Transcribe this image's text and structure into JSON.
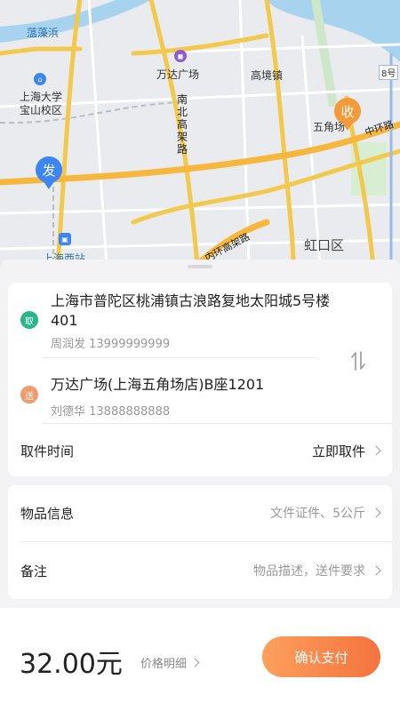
{
  "map": {
    "places": {
      "zaobang": "蕰藻浜",
      "wanda": "万达广场",
      "gaojing": "高境镇",
      "shu_univ": "上海大学",
      "shu_campus": "宝山校区",
      "wujiaochang": "五角场",
      "zhonghuan": "中环路",
      "hongkou": "虹口区",
      "sh_west": "上海西站",
      "neihuan": "内环高架路",
      "nanbei_chars": [
        "南",
        "北",
        "高",
        "架",
        "路"
      ],
      "metro8": "8号"
    },
    "start_pin": "发",
    "end_pin": "收"
  },
  "order": {
    "pickup": {
      "badge": "取",
      "address": "上海市普陀区桃浦镇古浪路复地太阳城5号楼401",
      "contact": "周润发 13999999999"
    },
    "delivery": {
      "badge": "送",
      "address": "万达广场(上海五角场店)B座1201",
      "contact": "刘德华 13888888888"
    },
    "pickup_time": {
      "label": "取件时间",
      "value": "立即取件"
    }
  },
  "item": {
    "info": {
      "label": "物品信息",
      "value": "文件证件、5公斤"
    },
    "note": {
      "label": "备注",
      "placeholder": "物品描述，送件要求"
    }
  },
  "footer": {
    "price": "32.00元",
    "detail": "价格明细",
    "pay": "确认支付"
  },
  "colors": {
    "pick_badge": "#2bb58a",
    "send_badge": "#f39a6a",
    "start_pin": "#3b86f2",
    "end_pin": "#f39a3c",
    "pay_gradient_start": "#fda05c",
    "pay_gradient_end": "#f4733e"
  }
}
